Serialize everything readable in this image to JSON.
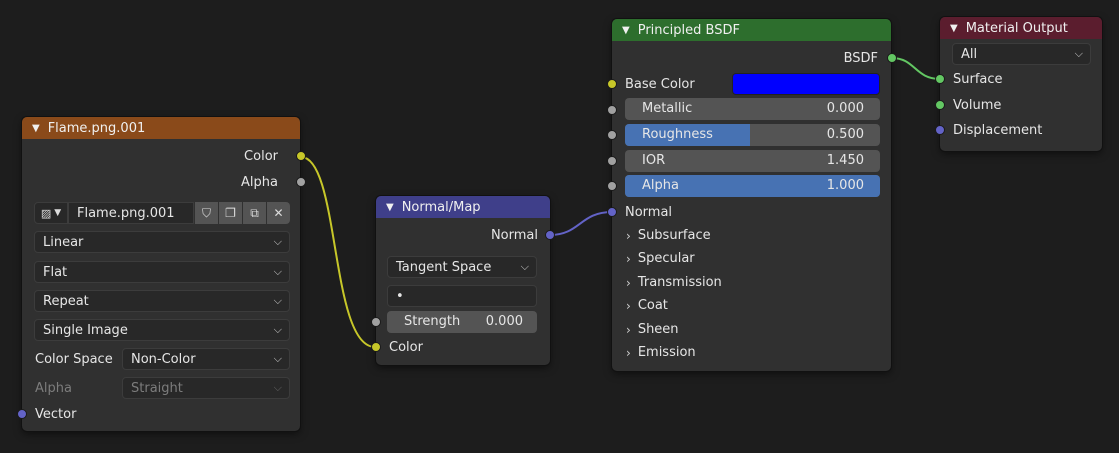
{
  "nodes": {
    "image": {
      "title": "Flame.png.001",
      "outputs": {
        "color": "Color",
        "alpha": "Alpha"
      },
      "image_name": "Flame.png.001",
      "interpolation": "Linear",
      "projection": "Flat",
      "extension": "Repeat",
      "source": "Single Image",
      "color_space_label": "Color Space",
      "color_space_value": "Non-Color",
      "alpha_label": "Alpha",
      "alpha_value": "Straight",
      "vector_label": "Vector"
    },
    "normal_map": {
      "title": "Normal/Map",
      "output": "Normal",
      "space": "Tangent Space",
      "uv_map": "•",
      "strength_label": "Strength",
      "strength_value": "0.000",
      "color_label": "Color"
    },
    "bsdf": {
      "title": "Principled BSDF",
      "output": "BSDF",
      "base_color_label": "Base Color",
      "base_color_hex": "#0000ff",
      "metallic_label": "Metallic",
      "metallic_value": "0.000",
      "metallic": 0.0,
      "roughness_label": "Roughness",
      "roughness_value": "0.500",
      "roughness": 0.5,
      "ior_label": "IOR",
      "ior_value": "1.450",
      "alpha_label": "Alpha",
      "alpha_value": "1.000",
      "alpha": 1.0,
      "normal_label": "Normal",
      "panels": [
        "Subsurface",
        "Specular",
        "Transmission",
        "Coat",
        "Sheen",
        "Emission"
      ]
    },
    "output": {
      "title": "Material Output",
      "target": "All",
      "inputs": {
        "surface": "Surface",
        "volume": "Volume",
        "displacement": "Displacement"
      }
    }
  },
  "colors": {
    "header_image": "#8a4a1a",
    "header_vector": "#3f3f8a",
    "header_shader": "#2d6e2d",
    "header_output": "#5b1d2e",
    "socket_color": "#c7c729",
    "socket_float": "#a1a1a1",
    "socket_vector": "#6363c7",
    "socket_shader": "#63c763",
    "slider_fill": "#4772b3"
  },
  "icons": {
    "collapse": "chevron-down-icon",
    "expand": "chevron-right-icon",
    "image_type": "image-icon",
    "fake_user": "shield-icon",
    "duplicate": "duplicate-icon",
    "browse": "folder-stack-icon",
    "unlink": "close-icon"
  }
}
